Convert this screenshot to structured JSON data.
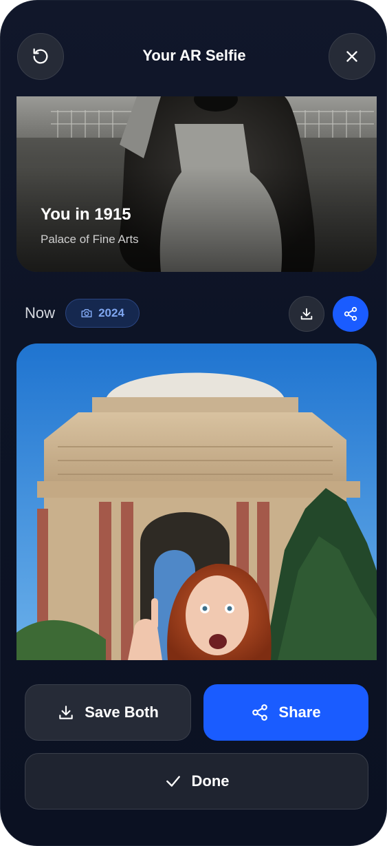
{
  "header": {
    "title": "Your AR Selfie"
  },
  "then_card": {
    "title": "You in 1915",
    "subtitle": "Palace of Fine Arts"
  },
  "now_section": {
    "label": "Now",
    "year": "2024"
  },
  "actions": {
    "save_label": "Save Both",
    "share_label": "Share",
    "done_label": "Done"
  },
  "colors": {
    "accent": "#1a5cff",
    "background": "#0d1426",
    "button": "#262b37"
  }
}
